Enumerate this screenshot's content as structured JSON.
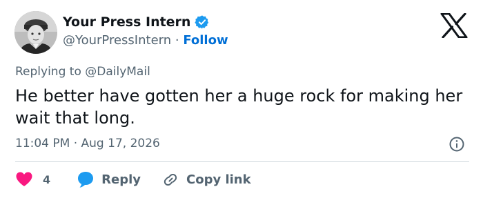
{
  "author": {
    "display_name": "Your Press Intern",
    "handle": "@YourPressIntern",
    "separator": " · ",
    "follow_label": "Follow",
    "verified": true
  },
  "reply_context": {
    "prefix": "Replying to ",
    "mention": "@DailyMail"
  },
  "tweet": {
    "text": "He better have gotten her a huge rock for making her wait that long.",
    "timestamp": "11:04 PM · Aug 17, 2026"
  },
  "actions": {
    "like_count": "4",
    "reply_label": "Reply",
    "copy_link_label": "Copy link"
  },
  "colors": {
    "like": "#f91880",
    "reply": "#1d9bf0",
    "verified": "#1d9bf0",
    "follow": "#006fd6",
    "muted": "#536471"
  },
  "icons": {
    "brand": "x-logo-icon",
    "verified": "verified-badge-icon",
    "info": "info-icon",
    "like": "heart-icon",
    "reply": "reply-bubble-icon",
    "copy": "link-icon"
  }
}
